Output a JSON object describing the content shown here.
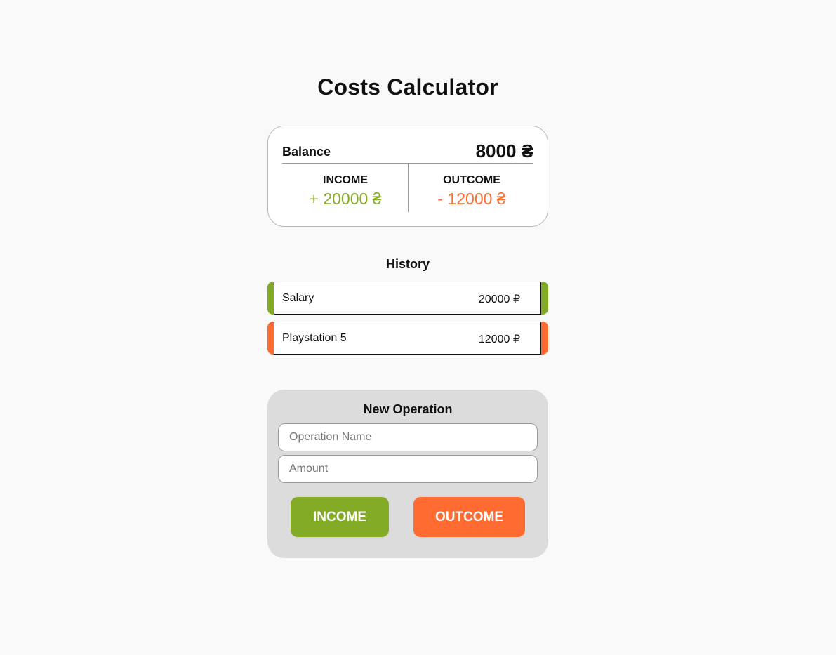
{
  "title": "Costs Calculator",
  "balance": {
    "label": "Balance",
    "value": "8000 ₴"
  },
  "income": {
    "label": "INCOME",
    "value": "+ 20000 ₴"
  },
  "outcome": {
    "label": "OUTCOME",
    "value": "- 12000 ₴"
  },
  "history": {
    "title": "History",
    "items": [
      {
        "name": "Salary",
        "amount": "20000 ₽",
        "type": "income"
      },
      {
        "name": "Playstation 5",
        "amount": "12000 ₽",
        "type": "outcome"
      }
    ]
  },
  "new_operation": {
    "title": "New Operation",
    "name_placeholder": "Operation Name",
    "amount_placeholder": "Amount",
    "income_button": "INCOME",
    "outcome_button": "OUTCOME"
  },
  "colors": {
    "income": "#84ab25",
    "outcome": "#ff6b30",
    "background": "#f9f9f9",
    "panel": "#dcdcdc"
  }
}
